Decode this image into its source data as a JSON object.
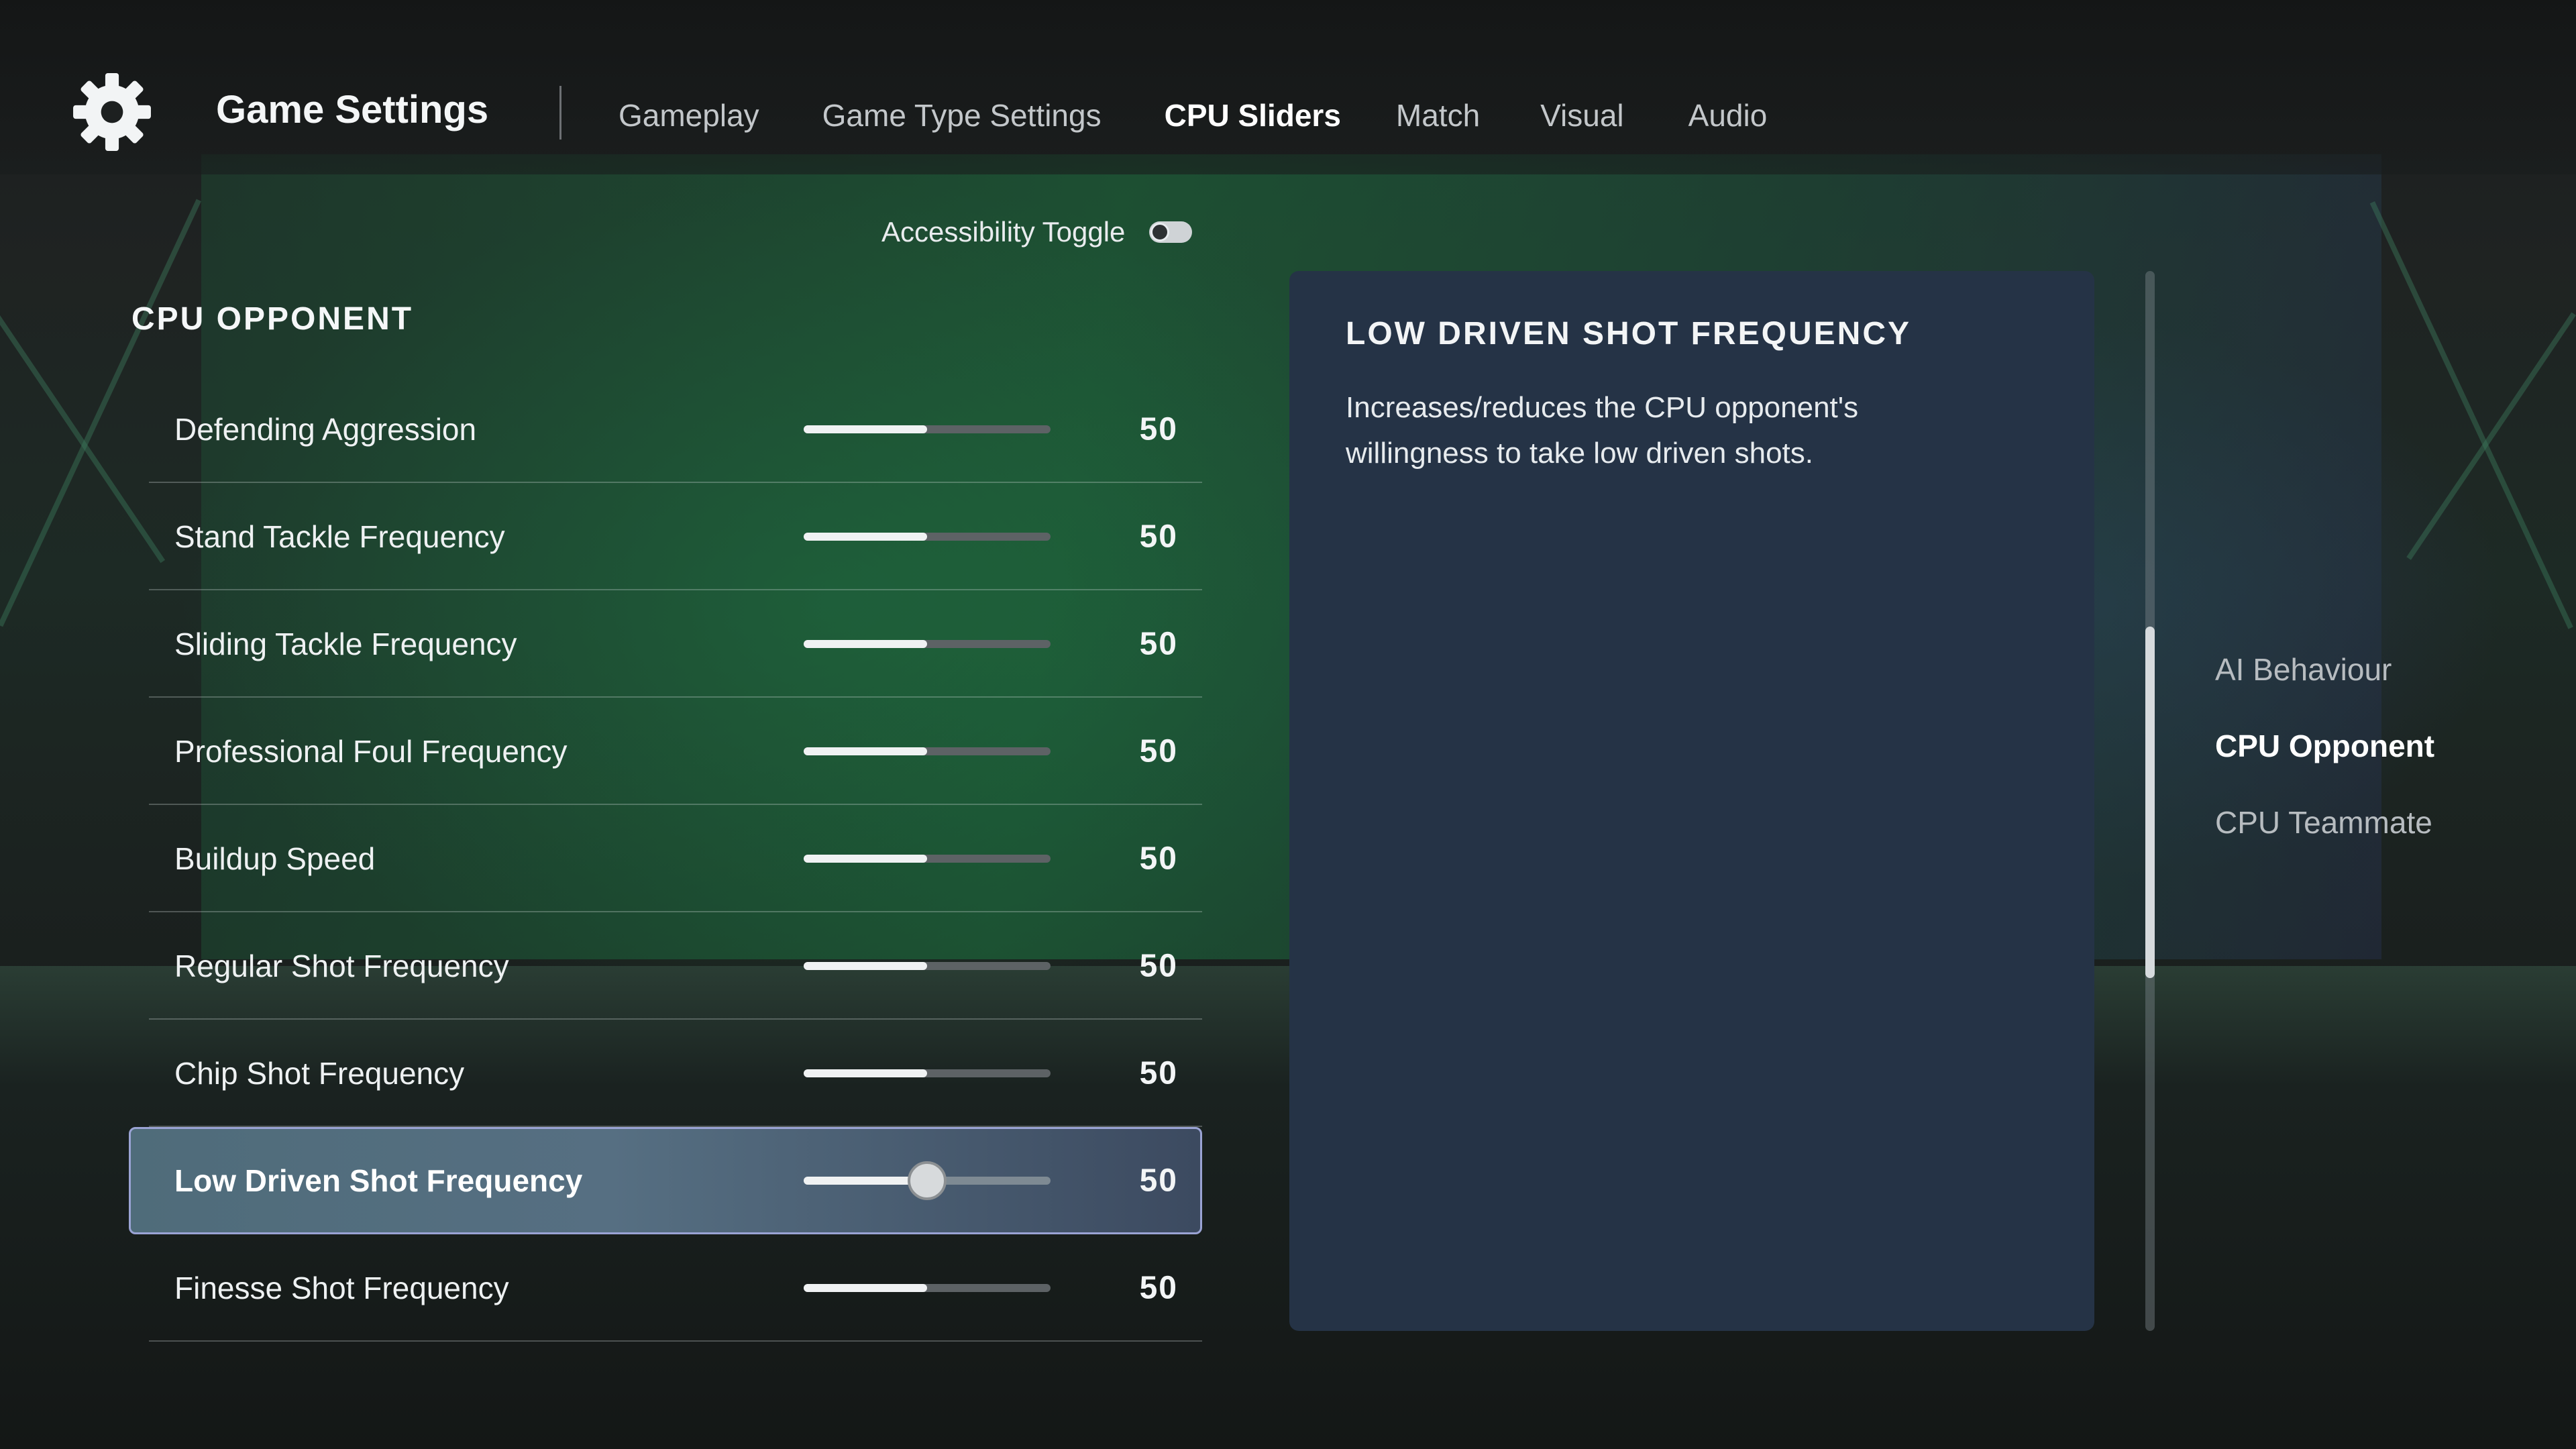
{
  "header": {
    "title": "Game Settings",
    "tabs": [
      {
        "label": "Gameplay",
        "active": false
      },
      {
        "label": "Game Type Settings",
        "active": false
      },
      {
        "label": "CPU Sliders",
        "active": true
      },
      {
        "label": "Match",
        "active": false
      },
      {
        "label": "Visual",
        "active": false
      },
      {
        "label": "Audio",
        "active": false
      }
    ]
  },
  "accessibility": {
    "label": "Accessibility Toggle",
    "on": false
  },
  "section": {
    "title": "CPU OPPONENT"
  },
  "sliders": [
    {
      "label": "Defending Aggression",
      "value": "50",
      "selected": false
    },
    {
      "label": "Stand Tackle Frequency",
      "value": "50",
      "selected": false
    },
    {
      "label": "Sliding Tackle Frequency",
      "value": "50",
      "selected": false
    },
    {
      "label": "Professional Foul Frequency",
      "value": "50",
      "selected": false
    },
    {
      "label": "Buildup Speed",
      "value": "50",
      "selected": false
    },
    {
      "label": "Regular Shot Frequency",
      "value": "50",
      "selected": false
    },
    {
      "label": "Chip Shot Frequency",
      "value": "50",
      "selected": false
    },
    {
      "label": "Low Driven Shot Frequency",
      "value": "50",
      "selected": true
    },
    {
      "label": "Finesse Shot Frequency",
      "value": "50",
      "selected": false
    }
  ],
  "description": {
    "title": "LOW DRIVEN SHOT FREQUENCY",
    "body": "Increases/reduces the CPU opponent's willingness to take low driven shots."
  },
  "categories": [
    {
      "label": "AI Behaviour",
      "active": false
    },
    {
      "label": "CPU Opponent",
      "active": true
    },
    {
      "label": "CPU Teammate",
      "active": false
    }
  ],
  "colors": {
    "selected_row": "#566f82",
    "panel": "#253346",
    "accent_border": "#9aa3d4"
  }
}
